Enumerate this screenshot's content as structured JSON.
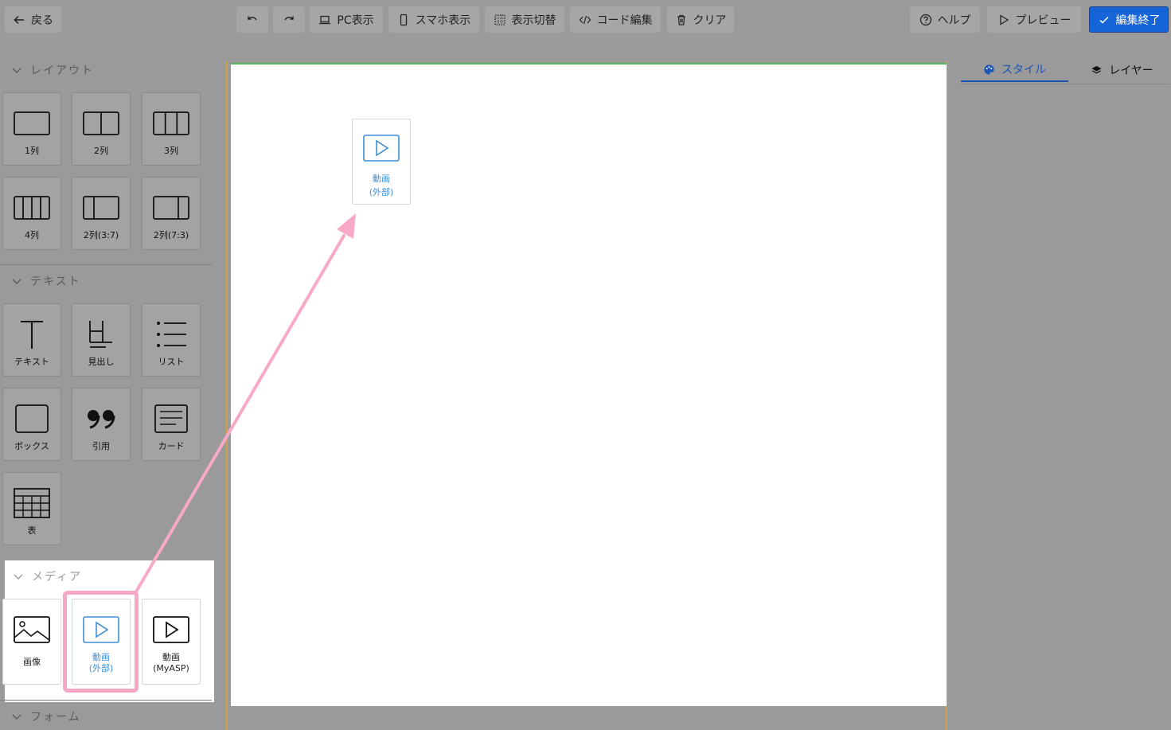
{
  "toolbar": {
    "back": "戻る",
    "undo_icon": "undo-icon",
    "redo_icon": "redo-icon",
    "pc_view": "PC表示",
    "sp_view": "スマホ表示",
    "toggle_view": "表示切替",
    "code_edit": "コード編集",
    "clear": "クリア",
    "help": "ヘルプ",
    "preview": "プレビュー",
    "finish": "編集終了"
  },
  "sidebar": {
    "layout": {
      "title": "レイアウト",
      "items": [
        "1列",
        "2列",
        "3列",
        "4列",
        "2列(3:7)",
        "2列(7:3)"
      ]
    },
    "text": {
      "title": "テキスト",
      "items": [
        "テキスト",
        "見出し",
        "リスト",
        "ボックス",
        "引用",
        "カード",
        "表"
      ]
    },
    "media": {
      "title": "メディア",
      "items": [
        "画像",
        "動画\n(外部)",
        "動画\n(MyASP)"
      ]
    },
    "form": {
      "title": "フォーム"
    }
  },
  "canvas": {
    "placed_label": "動画\n(外部)"
  },
  "right_panel": {
    "tab_style": "スタイル",
    "tab_layer": "レイヤー"
  },
  "colors": {
    "primary": "#1565d8",
    "accent_blue": "#3d8fd6",
    "highlight_pink": "#f7a7c6",
    "arrow_pink": "#f8a9c8"
  }
}
